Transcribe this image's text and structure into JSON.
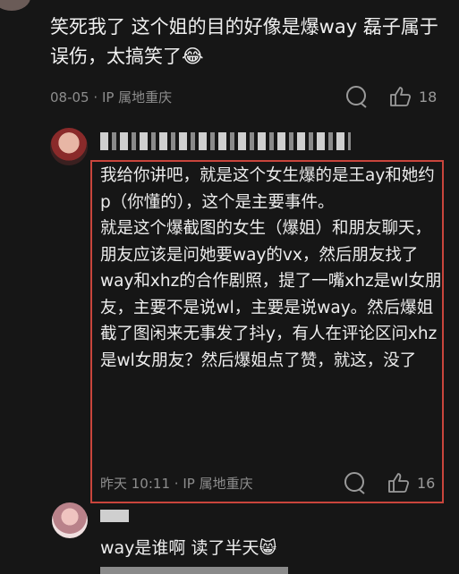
{
  "comments": [
    {
      "text": "笑死我了 这个姐的目的好像是爆way 磊子属于误伤，太搞笑了😂",
      "date": "08-05",
      "location": "IP 属地重庆",
      "likes": "18"
    }
  ],
  "reply": {
    "paragraphs": [
      "我给你讲吧，就是这个女生爆的是王ay和她约p（你懂的），这个是主要事件。",
      "就是这个爆截图的女生（爆姐）和朋友聊天，朋友应该是问她要way的vx，然后朋友找了way和xhz的合作剧照，提了一嘴xhz是wl女朋友，主要不是说wl，主要是说way。然后爆姐截了图闲来无事发了抖y，有人在评论区问xhz是wl女朋友？然后爆姐点了赞，就这，没了"
    ],
    "date": "昨天 10:11",
    "location": "IP 属地重庆",
    "likes": "16"
  },
  "comment3": {
    "text": "way是谁啊 读了半天😸"
  },
  "icons": {
    "reply": "speech-bubble-icon",
    "like": "thumbs-up-icon"
  },
  "colors": {
    "background": "#161616",
    "highlight": "#c9453c",
    "meta": "#8d8d8d"
  }
}
